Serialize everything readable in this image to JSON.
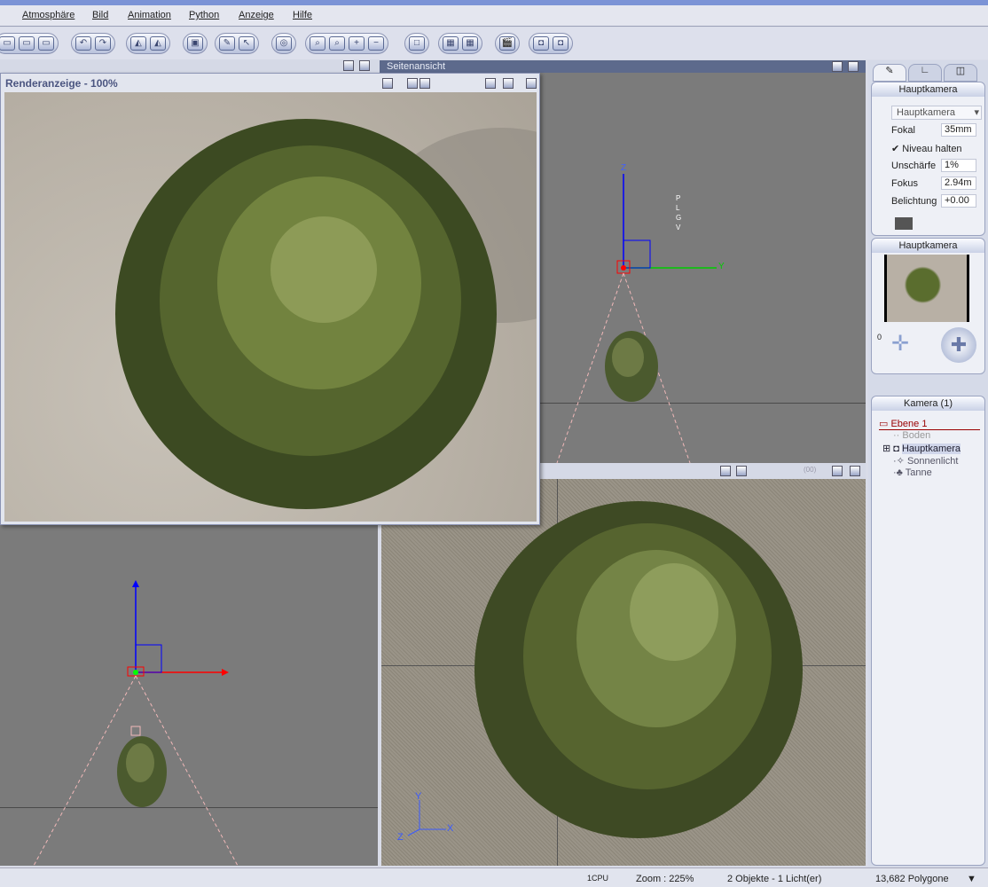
{
  "menu": [
    "Atmosphäre",
    "Bild",
    "Animation",
    "Python",
    "Anzeige",
    "Hilfe"
  ],
  "viewports": {
    "top_right_title": "Seitenansicht",
    "axis_z": "Z",
    "axis_y": "Y",
    "axis_x": "X",
    "cam_labels": [
      "P",
      "L",
      "G",
      "V"
    ],
    "zoom_box": "(00)"
  },
  "render": {
    "title": "Renderanzeige - 100%"
  },
  "panel": {
    "camera_header": "Hauptkamera",
    "camera_select": "Hauptkamera",
    "fokal_label": "Fokal",
    "fokal_value": "35mm",
    "niveau_label": "Niveau halten",
    "niveau_checked": true,
    "unschaerfe_label": "Unschärfe",
    "unschaerfe_value": "1%",
    "fokus_label": "Fokus",
    "fokus_value": "2.94m",
    "belichtung_label": "Belichtung",
    "belichtung_value": "+0.00",
    "preview_header": "Hauptkamera",
    "preview_counter": "0",
    "list_header": "Kamera (1)",
    "tree": [
      "Ebene 1",
      "Boden",
      "Hauptkamera",
      "Sonnenlicht",
      "Tanne"
    ]
  },
  "status": {
    "cpu": "1CPU",
    "zoom": "Zoom : 225%",
    "objects": "2 Objekte - 1 Licht(er)",
    "polygons": "13,682 Polygone"
  },
  "colors": {
    "axis_x": "#ff0000",
    "axis_y": "#00cc00",
    "axis_z": "#0000ff",
    "layer": "#990000"
  }
}
